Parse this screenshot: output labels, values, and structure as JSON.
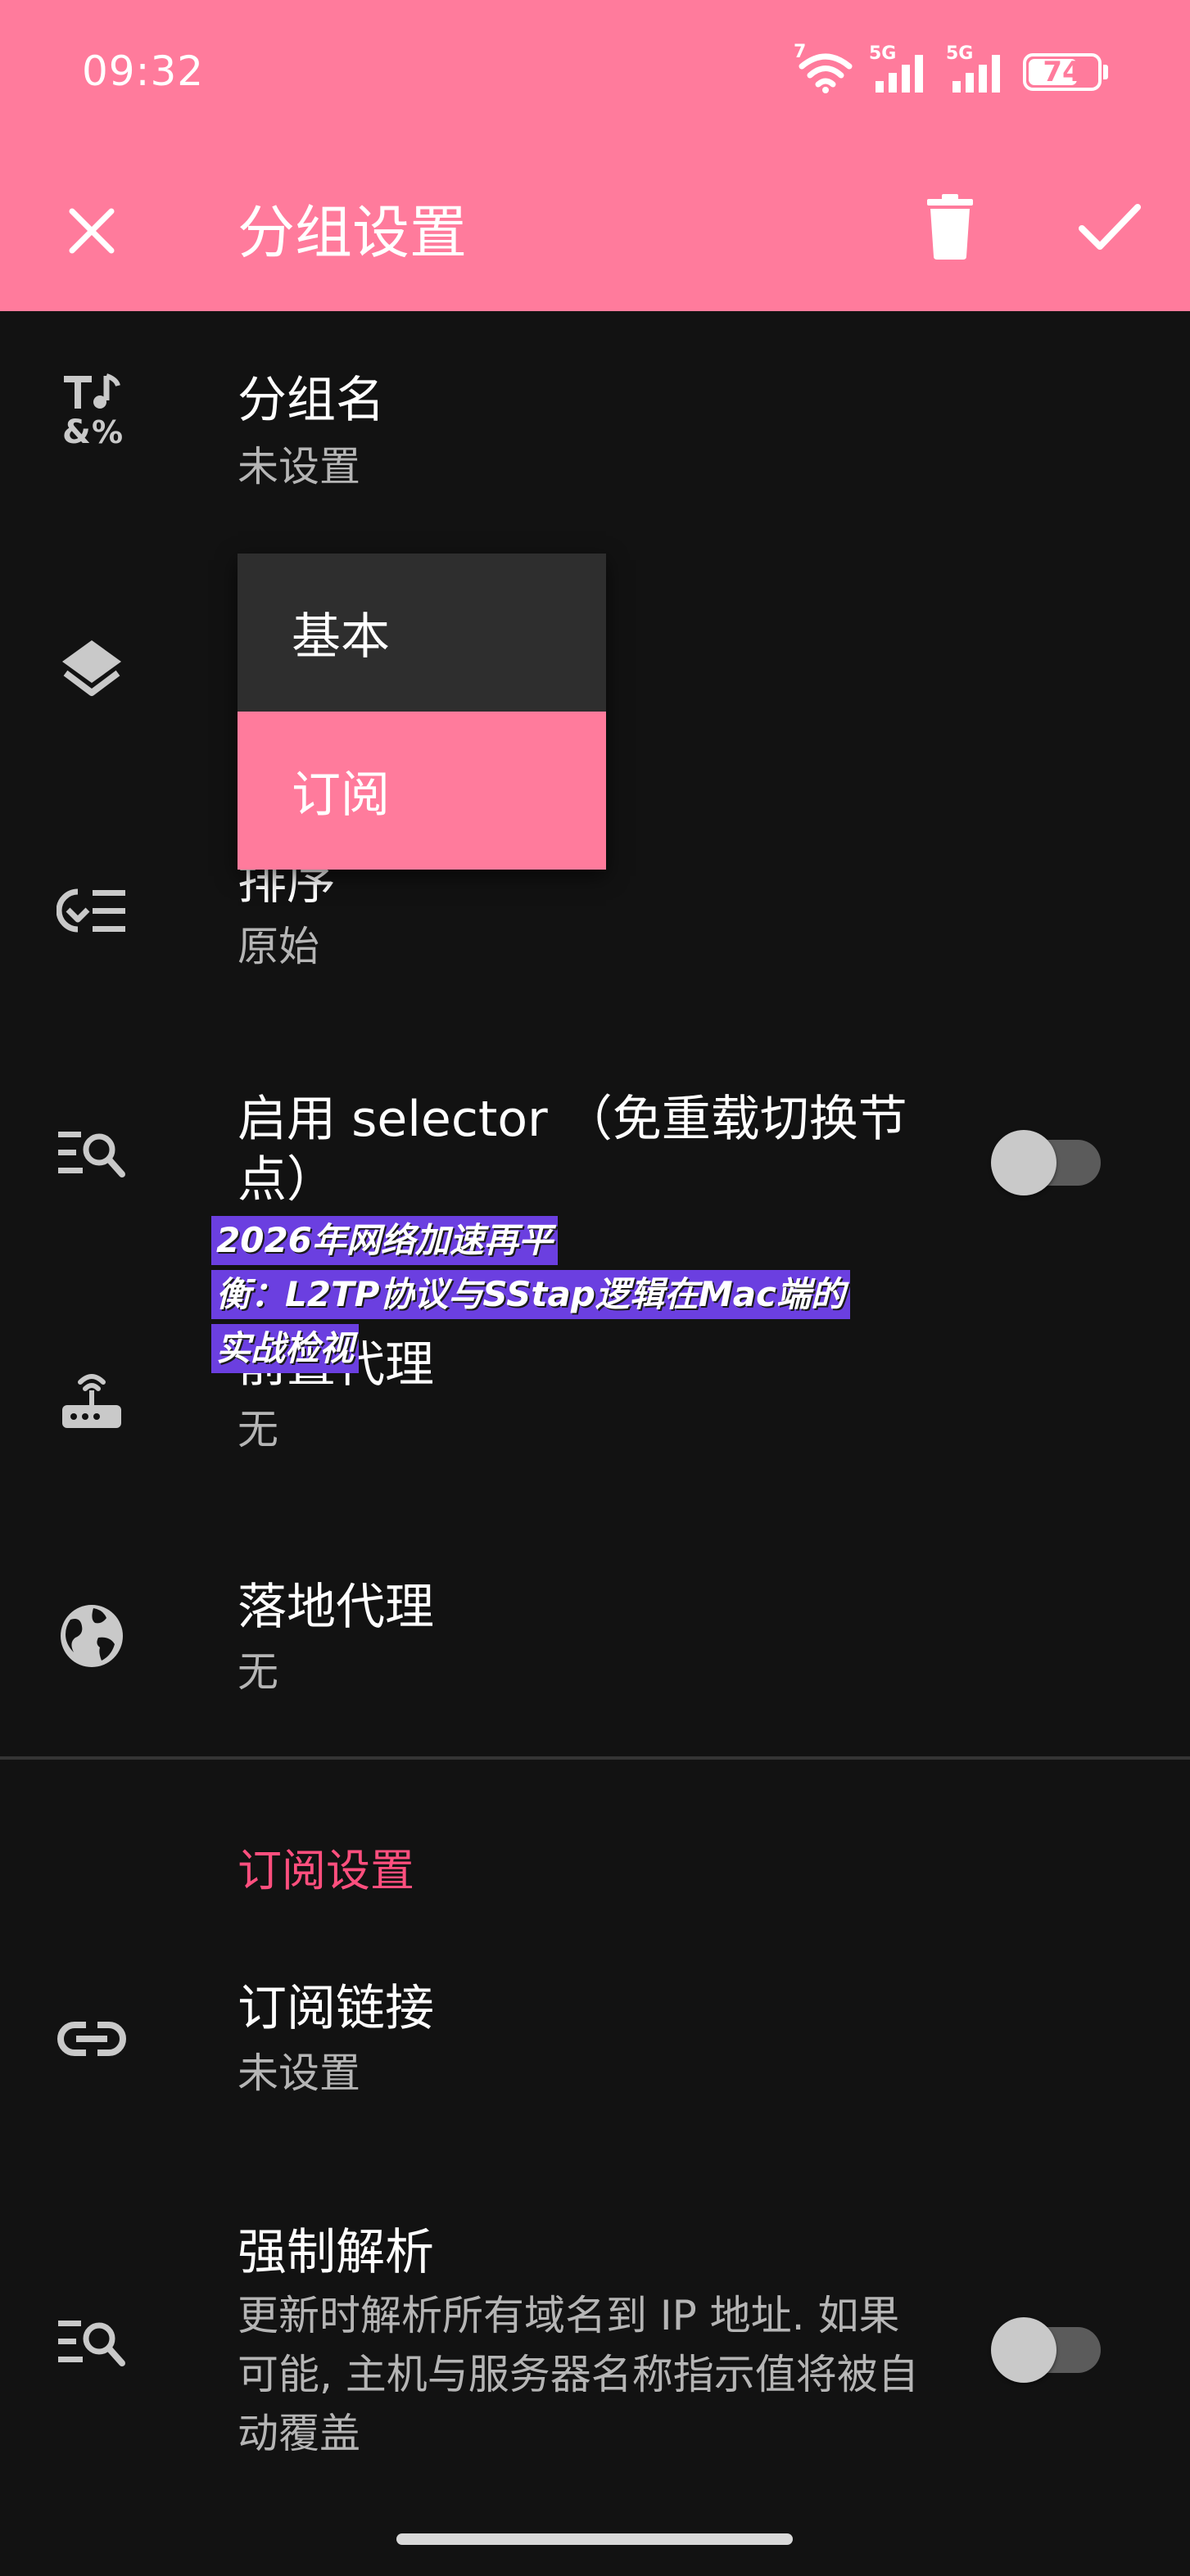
{
  "status_bar": {
    "time": "09:32",
    "signal_1_label": "5G",
    "signal_2_label": "5G",
    "wifi_badge": "7",
    "battery": "74",
    "battery_level_percent": 74
  },
  "app_bar": {
    "title": "分组设置",
    "close_icon": "close-icon",
    "delete_icon": "trash-icon",
    "confirm_icon": "check-icon",
    "background": "#FF7B9C"
  },
  "rows": {
    "group_name": {
      "title": "分组名",
      "summary": "未设置",
      "icon": "text-format-icon"
    },
    "group_type": {
      "icon": "layers-icon"
    },
    "sort": {
      "title": "排序",
      "summary": "原始",
      "icon": "sort-icon"
    },
    "selector": {
      "title": "启用 selector （免重载切换节点）",
      "icon": "search-list-icon",
      "enabled": false
    },
    "front_proxy": {
      "title": "前置代理",
      "summary": "无",
      "icon": "router-icon"
    },
    "landing_proxy": {
      "title": "落地代理",
      "summary": "无",
      "icon": "globe-icon"
    }
  },
  "dropdown": {
    "options": [
      "基本",
      "订阅"
    ],
    "selected": "订阅"
  },
  "subscription": {
    "section_title": "订阅设置",
    "link": {
      "title": "订阅链接",
      "summary": "未设置",
      "icon": "link-icon"
    },
    "force_resolve": {
      "title": "强制解析",
      "summary": "更新时解析所有域名到 IP 地址. 如果可能, 主机与服务器名称指示值将被自动覆盖",
      "icon": "search-list-icon",
      "enabled": false
    }
  },
  "overlay": {
    "lines": [
      "2026年网络加速再平",
      "衡：L2TP协议与SStap逻辑在Mac端的",
      "实战检视"
    ]
  },
  "colors": {
    "accent": "#FF7B9C",
    "section_accent": "#FF4F7E",
    "background": "#121212"
  }
}
